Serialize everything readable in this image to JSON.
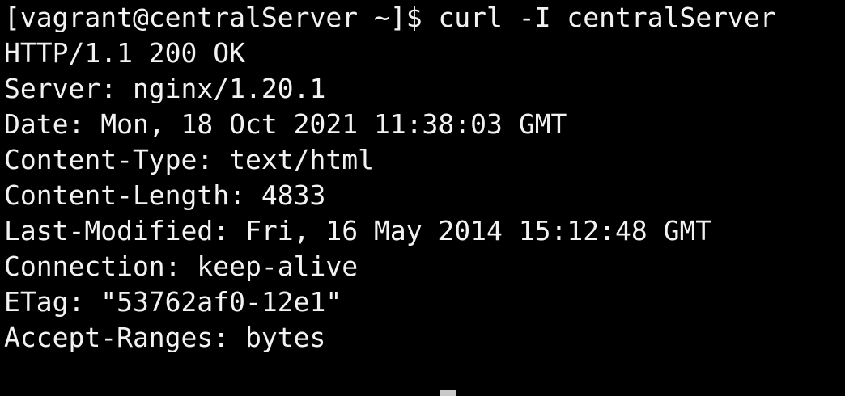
{
  "terminal": {
    "prompt": "[vagrant@centralServer ~]$",
    "command": "curl -I centralServer",
    "output": [
      "HTTP/1.1 200 OK",
      "Server: nginx/1.20.1",
      "Date: Mon, 18 Oct 2021 11:38:03 GMT",
      "Content-Type: text/html",
      "Content-Length: 4833",
      "Last-Modified: Fri, 16 May 2014 15:12:48 GMT",
      "Connection: keep-alive",
      "ETag: \"53762af0-12e1\"",
      "Accept-Ranges: bytes"
    ],
    "colors": {
      "background": "#000000",
      "foreground": "#f2f2f2",
      "cursor": "#c8c8c8"
    }
  }
}
